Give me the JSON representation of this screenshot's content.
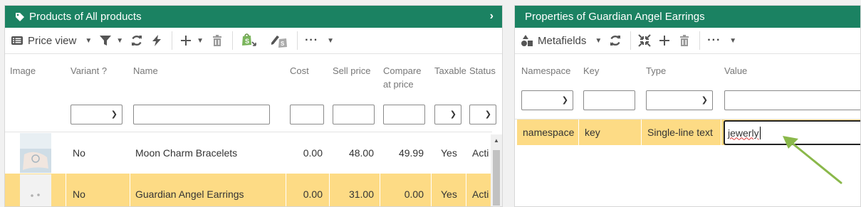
{
  "left": {
    "title": "Products of All products",
    "toolbar": {
      "view_label": "Price view"
    },
    "columns": [
      "Image",
      "Variant ?",
      "Name",
      "Cost",
      "Sell price",
      "Compare at price",
      "Taxable",
      "Status"
    ],
    "rows": [
      {
        "variant": "No",
        "name": "Moon Charm Bracelets",
        "cost": "0.00",
        "sell": "48.00",
        "compare": "49.99",
        "taxable": "Yes",
        "status": "Acti"
      },
      {
        "variant": "No",
        "name": "Guardian Angel Earrings",
        "cost": "0.00",
        "sell": "31.00",
        "compare": "0.00",
        "taxable": "Yes",
        "status": "Acti"
      }
    ]
  },
  "right": {
    "title": "Properties of Guardian Angel Earrings",
    "toolbar": {
      "view_label": "Metafields"
    },
    "columns": [
      "Namespace",
      "Key",
      "Type",
      "Value"
    ],
    "row": {
      "namespace": "namespace",
      "key": "key",
      "type": "Single-line text",
      "value": "jewerly"
    }
  },
  "colors": {
    "header": "#1b8262",
    "selected_row": "#fddb85",
    "arrow": "#8ab84a"
  }
}
